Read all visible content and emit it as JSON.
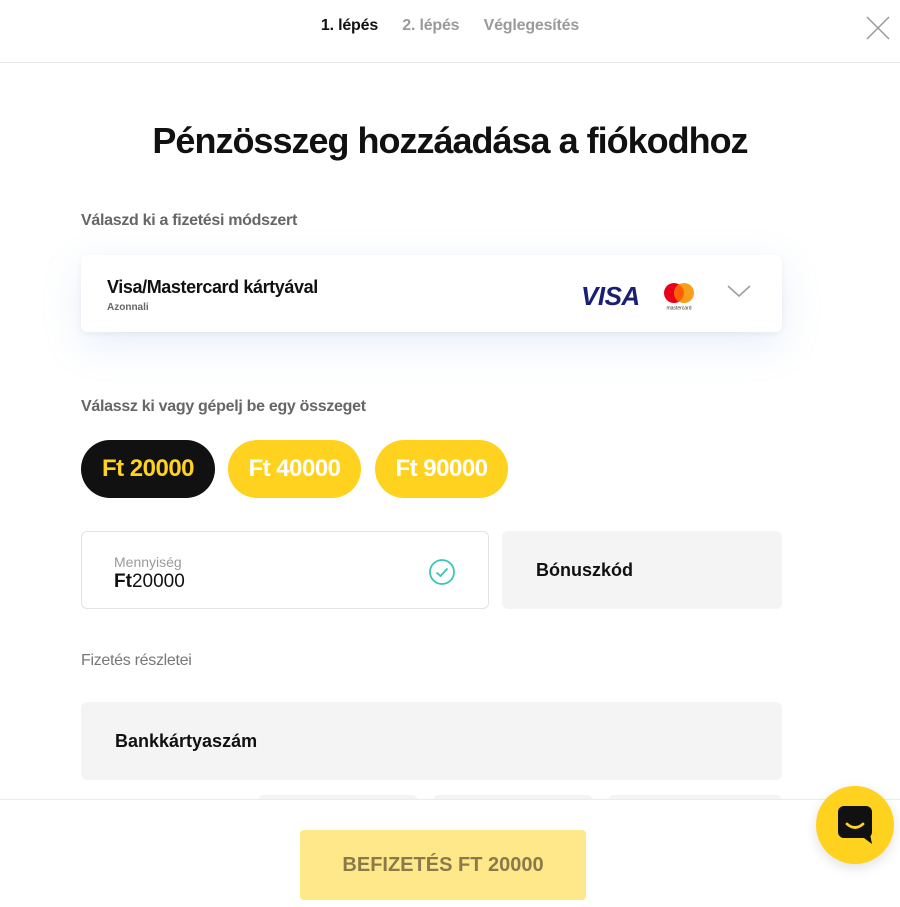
{
  "steps": {
    "step1": "1. lépés",
    "step2": "2. lépés",
    "final": "Véglegesítés"
  },
  "title": "Pénzösszeg hozzáadása a fiókodhoz",
  "payment_method": {
    "section_label": "Válaszd ki a fizetési módszert",
    "name": "Visa/Mastercard kártyával",
    "subtitle": "Azonnali",
    "visa_logo": "VISA",
    "mastercard_text": "mastercard"
  },
  "amount": {
    "section_label": "Válassz ki vagy gépelj be egy összeget",
    "options": [
      "Ft 20000",
      "Ft 40000",
      "Ft 90000"
    ],
    "selected_index": 0,
    "quantity_label": "Mennyiség",
    "currency": "Ft",
    "quantity_value": "20000",
    "bonus_placeholder": "Bónuszkód"
  },
  "details": {
    "section_label": "Fizetés részletei",
    "card_number_label": "Bankkártyaszám"
  },
  "submit_label": "BEFIZETÉS FT 20000",
  "colors": {
    "accent": "#ffd21f",
    "dark": "#111111",
    "success": "#3cc5b4"
  }
}
